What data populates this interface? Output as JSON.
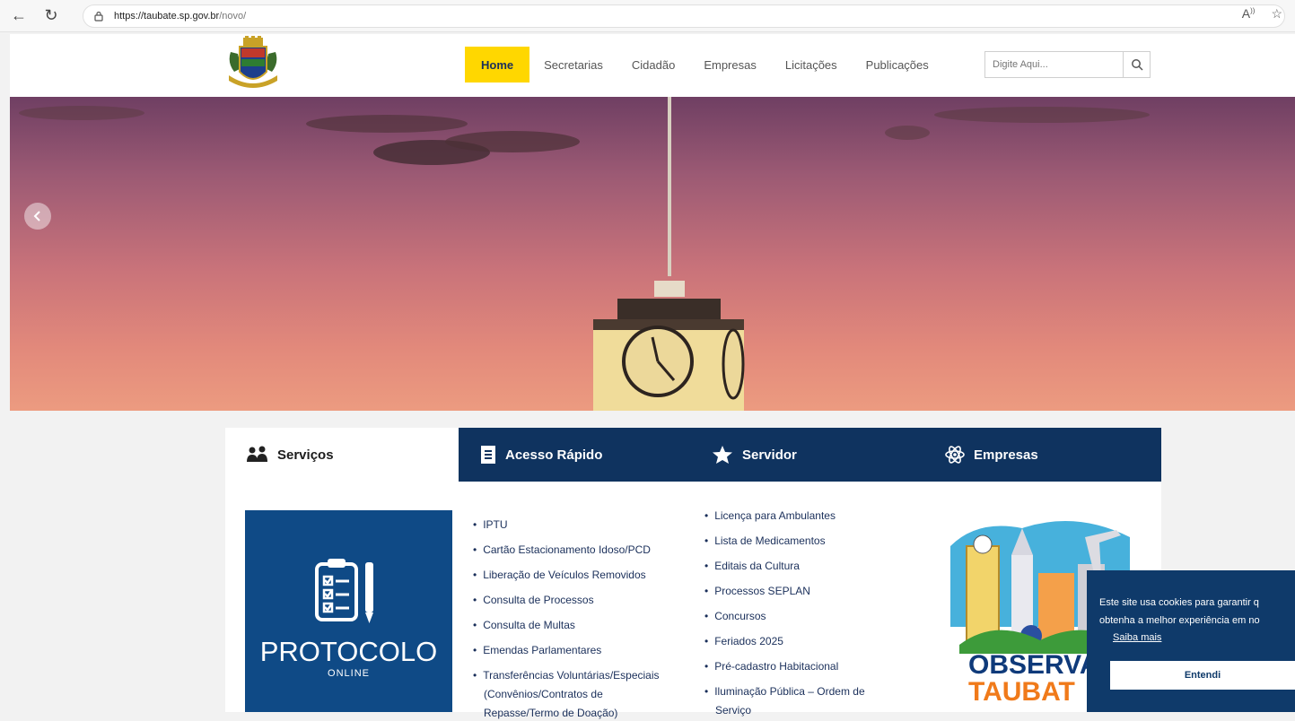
{
  "browser": {
    "url_host": "https://taubate.sp.gov.br",
    "url_path": "/novo/"
  },
  "header": {
    "menu": [
      {
        "label": "Home",
        "active": true
      },
      {
        "label": "Secretarias",
        "active": false
      },
      {
        "label": "Cidadão",
        "active": false
      },
      {
        "label": "Empresas",
        "active": false
      },
      {
        "label": "Licitações",
        "active": false
      },
      {
        "label": "Publicações",
        "active": false
      }
    ],
    "search_placeholder": "Digite Aqui..."
  },
  "tabs": {
    "services": "Serviços",
    "quick_access": "Acesso Rápido",
    "servidor": "Servidor",
    "empresas": "Empresas"
  },
  "protocolo": {
    "title": "PROTOCOLO",
    "subtitle": "ONLINE"
  },
  "links_col1": [
    "IPTU",
    "Cartão Estacionamento Idoso/PCD",
    "Liberação de Veículos Removidos",
    "Consulta de Processos",
    "Consulta de Multas",
    "Emendas Parlamentares",
    "Transferências Voluntárias/Especiais",
    "(Convênios/Contratos de",
    "Repasse/Termo de Doação)"
  ],
  "links_col2": [
    "Licença para Ambulantes",
    "Lista de Medicamentos",
    "Editais da Cultura",
    "Processos SEPLAN",
    "Concursos",
    "Feriados 2025",
    "Pré-cadastro Habitacional",
    "Iluminação Pública – Ordem de",
    "Serviço"
  ],
  "observa": {
    "line1": "OBSERVA",
    "line2": "TAUBAT"
  },
  "cookie": {
    "line1": "Este site usa cookies para garantir q",
    "line2": "obtenha a melhor experiência em no",
    "more": "Saiba mais",
    "accept": "Entendi"
  },
  "colors": {
    "nav_active": "#ffd700",
    "dark_blue": "#0f335f",
    "protocol_blue": "#0f4a86",
    "orange": "#f07a1a"
  }
}
